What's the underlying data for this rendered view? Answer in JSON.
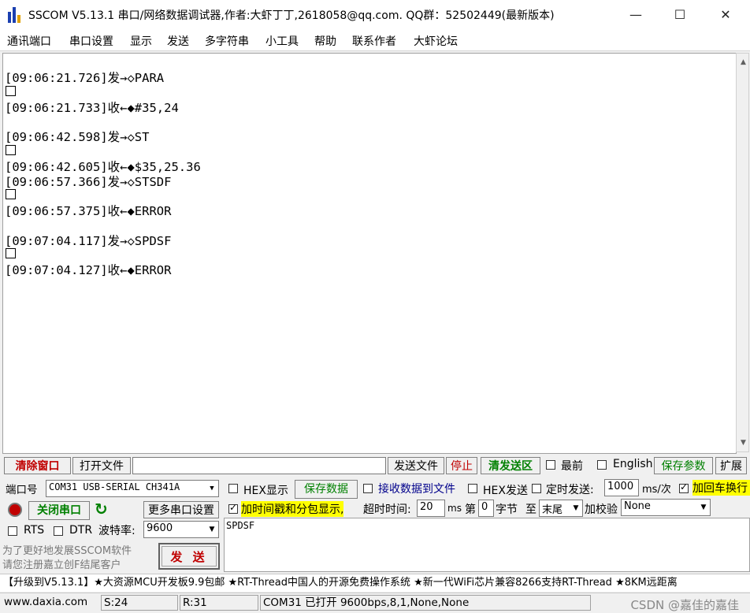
{
  "window": {
    "title": "SSCOM V5.13.1 串口/网络数据调试器,作者:大虾丁丁,2618058@qq.com. QQ群：52502449(最新版本)",
    "minimize": "—",
    "maximize": "☐",
    "close": "✕"
  },
  "menu": [
    "通讯端口",
    "串口设置",
    "显示",
    "发送",
    "多字符串",
    "小工具",
    "帮助",
    "联系作者",
    "大虾论坛"
  ],
  "log": [
    "[09:06:21.726]发→◇PARA",
    "[09:06:21.733]收←◆#35,24",
    "[09:06:42.598]发→◇ST",
    "[09:06:42.605]收←◆$35,25.36",
    "[09:06:57.366]发→◇STSDF",
    "[09:06:57.375]收←◆ERROR",
    "[09:07:04.117]发→◇SPDSF",
    "[09:07:04.127]收←◆ERROR"
  ],
  "toolbar1": {
    "clear": "清除窗口",
    "open_file": "打开文件",
    "send_file": "发送文件",
    "stop": "停止",
    "clear_send": "清发送区",
    "topmost": "最前",
    "english": "English",
    "save_params": "保存参数",
    "expand": "扩展"
  },
  "port": {
    "label": "端口号",
    "value": "COM31 USB-SERIAL CH341A",
    "hex_display": "HEX显示",
    "save_data": "保存数据",
    "receive_to_file": "接收数据到文件",
    "hex_send": "HEX发送",
    "timed_send": "定时发送:",
    "interval": "1000",
    "interval_unit": "ms/次",
    "append_crlf": "加回车换行"
  },
  "controls": {
    "close_port": "关闭串口",
    "more_settings": "更多串口设置",
    "timestamp": "加时间戳和分包显示,",
    "timeout_label": "超时时间:",
    "timeout": "20",
    "timeout_unit": "ms",
    "byte_prefix": "第",
    "byte_index": "0",
    "byte_suffix": "字节",
    "to": "至",
    "end": "末尾",
    "checksum_label": "加校验",
    "checksum": "None",
    "rts": "RTS",
    "dtr": "DTR",
    "baud_label": "波特率:",
    "baud": "9600",
    "send": "发 送"
  },
  "promo": {
    "line1": "为了更好地发展SSCOM软件",
    "line2": "请您注册嘉立创F结尾客户"
  },
  "send_text": "SPDSF",
  "ticker": "【升级到V5.13.1】★大资源MCU开发板9.9包邮 ★RT-Thread中国人的开源免费操作系统 ★新一代WiFi芯片兼容8266支持RT-Thread ★8KM远距离",
  "status": {
    "website": "www.daxia.com",
    "sent": "S:24",
    "received": "R:31",
    "port_status": "COM31 已打开  9600bps,8,1,None,None"
  },
  "watermark": "CSDN @嘉佳的嘉佳",
  "colors": {
    "highlight_yellow": "#ffff00",
    "red_text": "#c00000",
    "green_text": "#008000",
    "blue_text": "#00008b"
  }
}
